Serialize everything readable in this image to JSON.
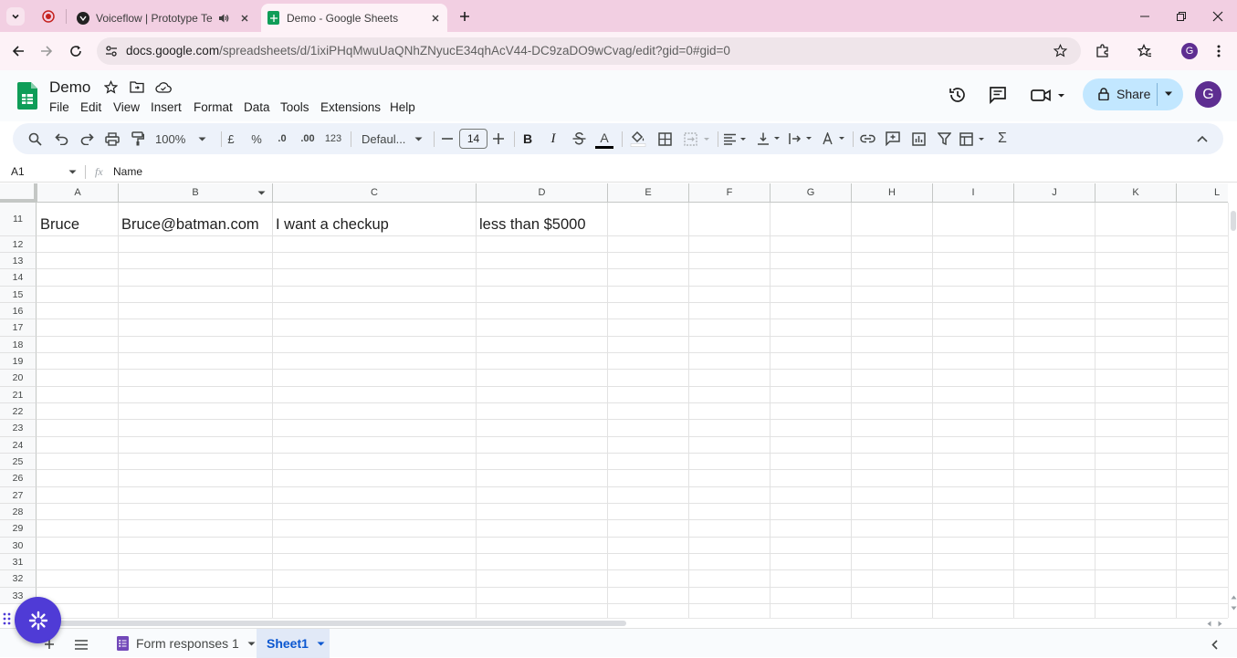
{
  "browser": {
    "tabs": [
      {
        "title": "Voiceflow | Prototype Testing",
        "icon": "voiceflow-icon",
        "audio": true,
        "active": false
      },
      {
        "title": "Demo - Google Sheets",
        "icon": "sheets-icon",
        "active": true
      }
    ],
    "url_domain": "docs.google.com",
    "url_path": "/spreadsheets/d/1ixiPHqMwuUaQNhZNyucE34qhAcV44-DC9zaDO9wCvag/edit?gid=0#gid=0",
    "profile_letter": "G"
  },
  "doc": {
    "title": "Demo",
    "menu": [
      "File",
      "Edit",
      "View",
      "Insert",
      "Format",
      "Data",
      "Tools",
      "Extensions",
      "Help"
    ],
    "share_label": "Share",
    "avatar_letter": "G"
  },
  "toolbar": {
    "zoom": "100%",
    "currency": "£",
    "percent": "%",
    "dec_decrease": ".0",
    "dec_increase": ".00",
    "number_format": "123",
    "font": "Defaul...",
    "font_size": "14",
    "bold": "B",
    "italic": "I",
    "text_color": "A",
    "sigma": "Σ"
  },
  "formula_bar": {
    "cell_ref": "A1",
    "fx": "fx",
    "content": "Name"
  },
  "grid": {
    "columns": [
      "A",
      "B",
      "C",
      "D",
      "E",
      "F",
      "G",
      "H",
      "I",
      "J",
      "K",
      "L"
    ],
    "rows": [
      "11",
      "12",
      "13",
      "14",
      "15",
      "16",
      "17",
      "18",
      "19",
      "20",
      "21",
      "22",
      "23",
      "24",
      "25",
      "26",
      "27",
      "28",
      "29",
      "30",
      "31",
      "32",
      "33"
    ],
    "row11": {
      "A": "Bruce",
      "B": "Bruce@batman.com",
      "C": "I want a checkup",
      "D": "less than $5000"
    }
  },
  "sheets": {
    "tabs": [
      "Form responses 1",
      "Sheet1"
    ],
    "active": "Sheet1"
  },
  "colors": {
    "tab_strip": "#f2cfe2",
    "address_row": "#fdf2f7",
    "share_button": "#c2e7ff",
    "sheets_green": "#0f9d58",
    "fab": "#4f3bd6",
    "active_sheet": "#0b57d0"
  }
}
